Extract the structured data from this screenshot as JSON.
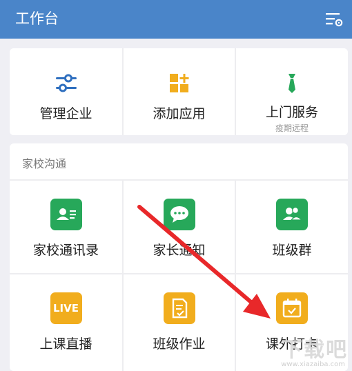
{
  "header": {
    "title": "工作台",
    "settings_icon": "filter-settings-icon"
  },
  "top_apps": [
    {
      "label": "管理企业",
      "icon": "sliders-icon",
      "color": "#2f6fbf"
    },
    {
      "label": "添加应用",
      "icon": "add-grid-icon",
      "color": "#f1ad1d"
    },
    {
      "label": "上门服务",
      "sublabel": "疫期远程",
      "icon": "necktie-icon",
      "color": "#27a85a"
    }
  ],
  "section": {
    "title": "家校沟通",
    "apps": [
      {
        "label": "家校通讯录",
        "icon": "contact-card-icon",
        "color": "#27a85a"
      },
      {
        "label": "家长通知",
        "icon": "chat-bubble-icon",
        "color": "#27a85a"
      },
      {
        "label": "班级群",
        "icon": "group-people-icon",
        "color": "#27a85a"
      },
      {
        "label": "上课直播",
        "icon_text": "LIVE",
        "icon": "live-icon",
        "color": "#f1ad1d"
      },
      {
        "label": "班级作业",
        "icon": "homework-doc-icon",
        "color": "#f1ad1d"
      },
      {
        "label": "课外打卡",
        "icon": "calendar-check-icon",
        "color": "#f1ad1d"
      }
    ]
  },
  "watermark": {
    "text": "下载吧",
    "url": "www.xiazaiba.com"
  }
}
